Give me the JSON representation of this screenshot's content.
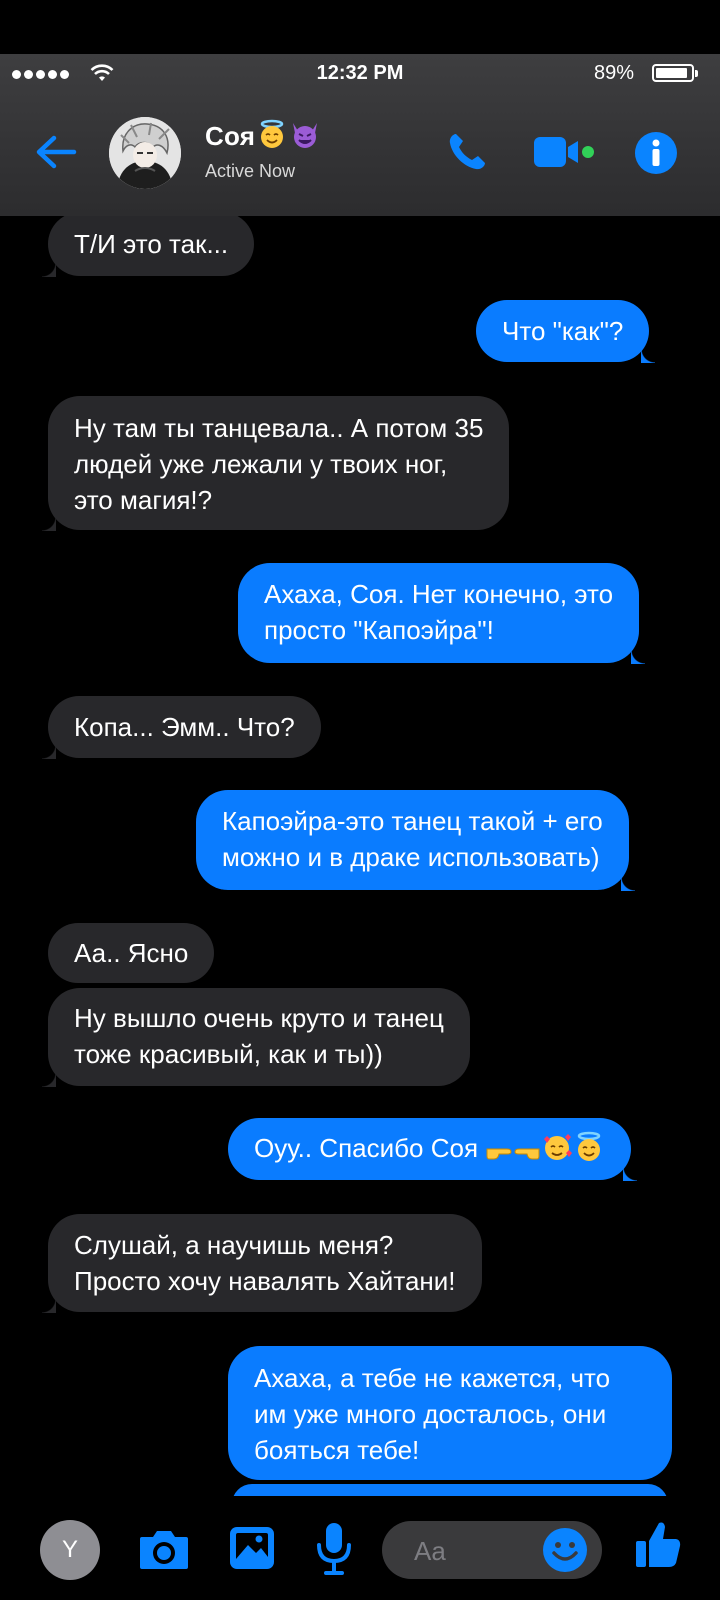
{
  "status_bar": {
    "time": "12:32 PM",
    "battery": "89%"
  },
  "header": {
    "contact_name": "Соя",
    "contact_emojis": [
      "angel-face",
      "smiling-devil"
    ],
    "status": "Active Now"
  },
  "messages": [
    {
      "from": "them",
      "text": "Т/И это так..."
    },
    {
      "from": "me",
      "text": "Что \"как\"?"
    },
    {
      "from": "them",
      "lines": [
        "Ну там ты танцевала.. А потом 35",
        "людей уже лежали у твоих ног,",
        "это магия!?"
      ]
    },
    {
      "from": "me",
      "lines": [
        "Ахаха, Соя. Нет конечно, это",
        "просто \"Капоэйра\"!"
      ]
    },
    {
      "from": "them",
      "text": "Копа... Эмм.. Что?"
    },
    {
      "from": "me",
      "lines": [
        "Капоэйра-это танец такой + его",
        "можно и в драке использовать)"
      ]
    },
    {
      "from": "them",
      "text": "Аа.. Ясно"
    },
    {
      "from": "them",
      "lines": [
        "Ну вышло очень круто и танец",
        "тоже красивый, как и ты))"
      ]
    },
    {
      "from": "me",
      "text": "Оуу.. Спасибо Соя",
      "emojis": [
        "pointing-right",
        "pointing-left",
        "smiling-face-with-hearts",
        "angel-face"
      ]
    },
    {
      "from": "them",
      "lines": [
        "Слушай, а научишь меня?",
        "Просто хочу навалять Хайтани!"
      ]
    },
    {
      "from": "me",
      "lines": [
        "Ахаха, а тебе не кажется, что",
        "им уже много досталось, они",
        "бояться тебе!"
      ]
    }
  ],
  "composer": {
    "avatar_letter": "Y",
    "placeholder": "Aa"
  },
  "colors": {
    "outgoing_bubble": "#0a7cff",
    "incoming_bubble": "#28282b",
    "accent": "#0a84ff"
  }
}
